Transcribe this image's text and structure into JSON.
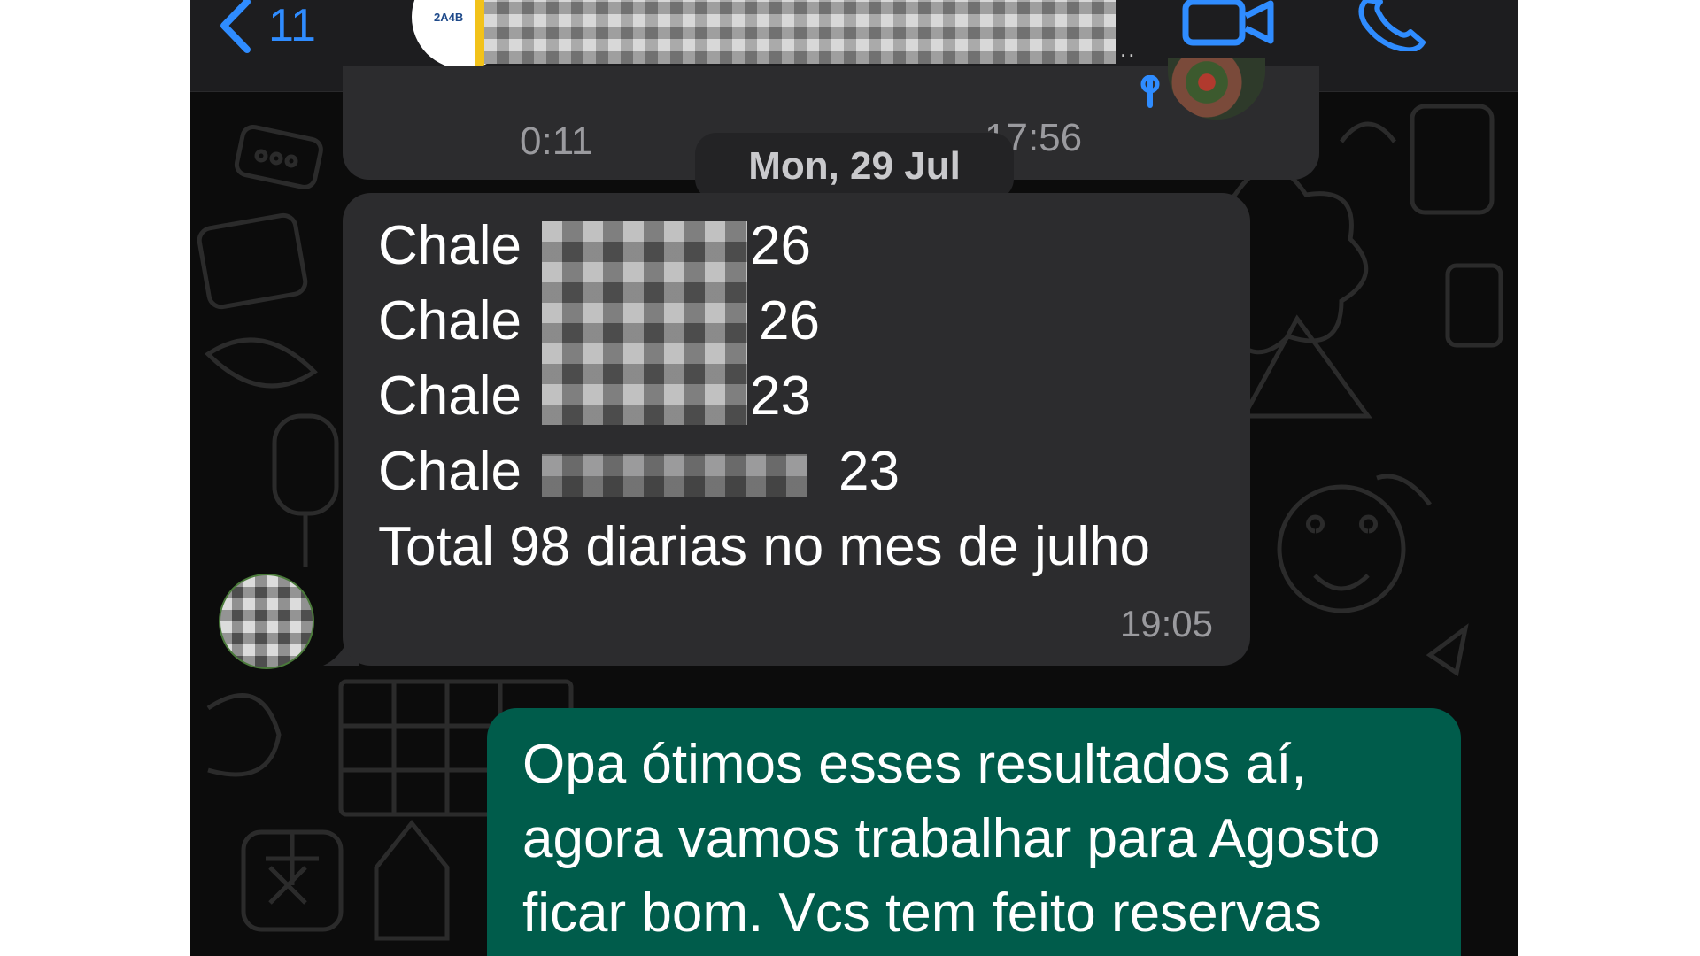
{
  "header": {
    "back_count": "11",
    "logo_text": "2A4B",
    "name_ellipsis": "..",
    "icons": [
      "chevron-left-icon",
      "video-call-icon",
      "phone-call-icon"
    ],
    "accent_color": "#2f8cff"
  },
  "previous_message": {
    "duration": "0:11",
    "time": "17:56"
  },
  "date_separator": "Mon, 29 Jul",
  "incoming_message": {
    "lines": [
      {
        "prefix": "Chale",
        "suffix": "26"
      },
      {
        "prefix": "Chale",
        "suffix": "26"
      },
      {
        "prefix": "Chale",
        "suffix": "23"
      },
      {
        "prefix": "Chale",
        "suffix": "23"
      }
    ],
    "total_line": "Total 98 diarias no mes de julho",
    "time": "19:05",
    "bubble_color": "#2c2c2e"
  },
  "outgoing_message": {
    "lines": [
      "Opa ótimos esses resultados aí,",
      "agora vamos trabalhar para Agosto",
      "ficar bom. Vcs tem feito reservas"
    ],
    "bubble_color": "#005c4b"
  }
}
